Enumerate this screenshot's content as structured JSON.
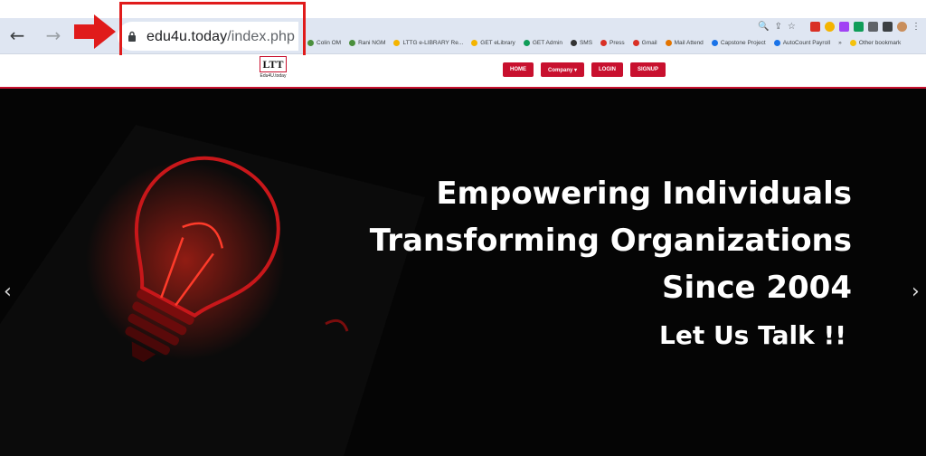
{
  "browser": {
    "url_host": "edu4u.today",
    "url_path": "/index.php",
    "back_glyph": "←",
    "forward_glyph": "→",
    "bookmarks": [
      {
        "label": "Colin OM",
        "color": "#4a8f3c"
      },
      {
        "label": "Rani NGM",
        "color": "#4a8f3c"
      },
      {
        "label": "LTTG e-LIBRARY Re...",
        "color": "#f4b400"
      },
      {
        "label": "GET eLibrary",
        "color": "#f4b400"
      },
      {
        "label": "GET Admin",
        "color": "#0f9d58"
      },
      {
        "label": "SMS",
        "color": "#333333"
      },
      {
        "label": "Press",
        "color": "#d93025"
      },
      {
        "label": "Gmail",
        "color": "#d93025"
      },
      {
        "label": "Mail Attend",
        "color": "#e37400"
      },
      {
        "label": "Capstone Project",
        "color": "#1a73e8"
      },
      {
        "label": "AutoCount Payroll",
        "color": "#1a73e8"
      },
      {
        "label": "»",
        "color": ""
      },
      {
        "label": "Other bookmark",
        "color": "#f4c20d"
      }
    ]
  },
  "site": {
    "logo_mark": "LTT",
    "logo_caption": "Edu4U.today",
    "nav": [
      {
        "label": "HOME"
      },
      {
        "label": "Company ▾"
      },
      {
        "label": "LOGIN"
      },
      {
        "label": "SIGNUP"
      }
    ],
    "accent_color": "#c8102e"
  },
  "hero": {
    "line1": "Empowering Individuals",
    "line2": "Transforming Organizations",
    "line3": "Since 2004",
    "line4": "Let Us Talk !!",
    "prev_glyph": "‹",
    "next_glyph": "›"
  }
}
